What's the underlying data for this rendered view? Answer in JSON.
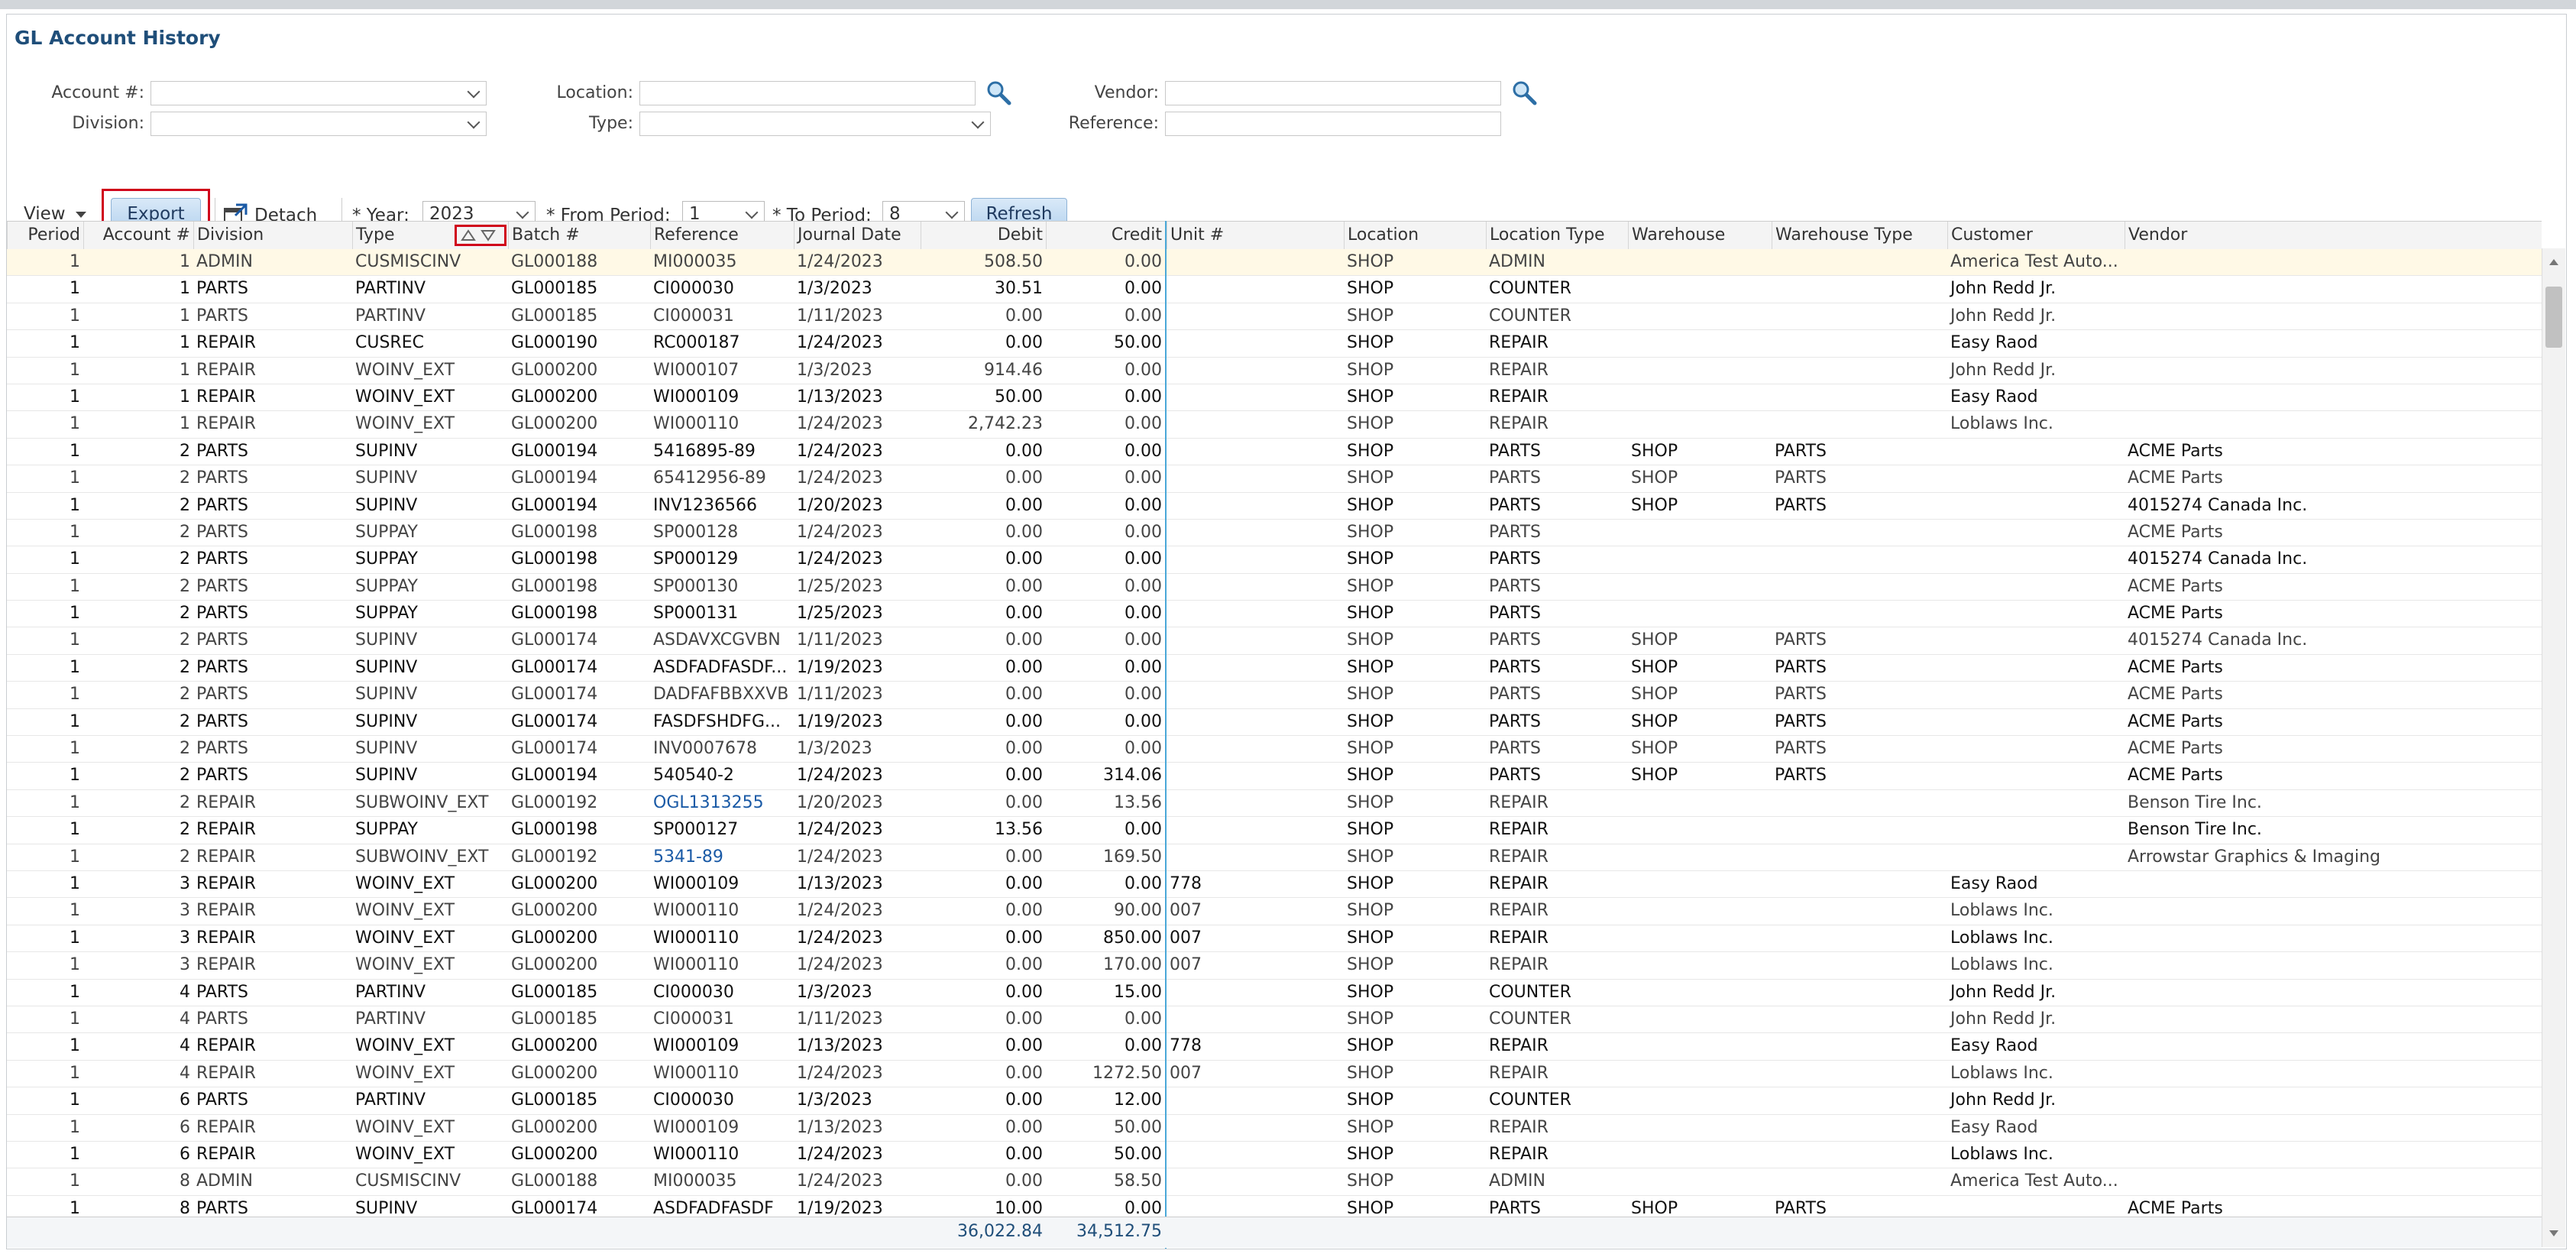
{
  "page": {
    "title": "GL Account History"
  },
  "filters": {
    "account_label": "Account #:",
    "division_label": "Division:",
    "location_label": "Location:",
    "type_label": "Type:",
    "vendor_label": "Vendor:",
    "reference_label": "Reference:",
    "account_value": "",
    "division_value": "",
    "location_value": "",
    "type_value": "",
    "vendor_value": "",
    "reference_value": ""
  },
  "toolbar": {
    "view_label": "View",
    "export_label": "Export",
    "detach_label": "Detach",
    "year_label": "* Year:",
    "year_value": "2023",
    "from_label": "* From Period:",
    "from_value": "1",
    "to_label": "* To Period:",
    "to_value": "8",
    "refresh_label": "Refresh"
  },
  "grid": {
    "columns": [
      "Period",
      "Account #",
      "Division",
      "Type",
      "Batch #",
      "Reference",
      "Journal Date",
      "Debit",
      "Credit",
      "Unit #",
      "Location",
      "Location Type",
      "Warehouse",
      "Warehouse Type",
      "Customer",
      "Vendor"
    ],
    "rows": [
      [
        "1",
        "1",
        "ADMIN",
        "CUSMISCINV",
        "GL000188",
        "MI000035",
        "1/24/2023",
        "508.50",
        "0.00",
        "",
        "SHOP",
        "ADMIN",
        "",
        "",
        "America Test Auto...",
        ""
      ],
      [
        "1",
        "1",
        "PARTS",
        "PARTINV",
        "GL000185",
        "CI000030",
        "1/3/2023",
        "30.51",
        "0.00",
        "",
        "SHOP",
        "COUNTER",
        "",
        "",
        "John Redd Jr.",
        ""
      ],
      [
        "1",
        "1",
        "PARTS",
        "PARTINV",
        "GL000185",
        "CI000031",
        "1/11/2023",
        "0.00",
        "0.00",
        "",
        "SHOP",
        "COUNTER",
        "",
        "",
        "John Redd Jr.",
        ""
      ],
      [
        "1",
        "1",
        "REPAIR",
        "CUSREC",
        "GL000190",
        "RC000187",
        "1/24/2023",
        "0.00",
        "50.00",
        "",
        "SHOP",
        "REPAIR",
        "",
        "",
        "Easy Raod",
        ""
      ],
      [
        "1",
        "1",
        "REPAIR",
        "WOINV_EXT",
        "GL000200",
        "WI000107",
        "1/3/2023",
        "914.46",
        "0.00",
        "",
        "SHOP",
        "REPAIR",
        "",
        "",
        "John Redd Jr.",
        ""
      ],
      [
        "1",
        "1",
        "REPAIR",
        "WOINV_EXT",
        "GL000200",
        "WI000109",
        "1/13/2023",
        "50.00",
        "0.00",
        "",
        "SHOP",
        "REPAIR",
        "",
        "",
        "Easy Raod",
        ""
      ],
      [
        "1",
        "1",
        "REPAIR",
        "WOINV_EXT",
        "GL000200",
        "WI000110",
        "1/24/2023",
        "2,742.23",
        "0.00",
        "",
        "SHOP",
        "REPAIR",
        "",
        "",
        "Loblaws Inc.",
        ""
      ],
      [
        "1",
        "2",
        "PARTS",
        "SUPINV",
        "GL000194",
        "5416895-89",
        "1/24/2023",
        "0.00",
        "0.00",
        "",
        "SHOP",
        "PARTS",
        "SHOP",
        "PARTS",
        "",
        "ACME Parts"
      ],
      [
        "1",
        "2",
        "PARTS",
        "SUPINV",
        "GL000194",
        "65412956-89",
        "1/24/2023",
        "0.00",
        "0.00",
        "",
        "SHOP",
        "PARTS",
        "SHOP",
        "PARTS",
        "",
        "ACME Parts"
      ],
      [
        "1",
        "2",
        "PARTS",
        "SUPINV",
        "GL000194",
        "INV1236566",
        "1/20/2023",
        "0.00",
        "0.00",
        "",
        "SHOP",
        "PARTS",
        "SHOP",
        "PARTS",
        "",
        "4015274 Canada Inc."
      ],
      [
        "1",
        "2",
        "PARTS",
        "SUPPAY",
        "GL000198",
        "SP000128",
        "1/24/2023",
        "0.00",
        "0.00",
        "",
        "SHOP",
        "PARTS",
        "",
        "",
        "",
        "ACME Parts"
      ],
      [
        "1",
        "2",
        "PARTS",
        "SUPPAY",
        "GL000198",
        "SP000129",
        "1/24/2023",
        "0.00",
        "0.00",
        "",
        "SHOP",
        "PARTS",
        "",
        "",
        "",
        "4015274 Canada Inc."
      ],
      [
        "1",
        "2",
        "PARTS",
        "SUPPAY",
        "GL000198",
        "SP000130",
        "1/25/2023",
        "0.00",
        "0.00",
        "",
        "SHOP",
        "PARTS",
        "",
        "",
        "",
        "ACME Parts"
      ],
      [
        "1",
        "2",
        "PARTS",
        "SUPPAY",
        "GL000198",
        "SP000131",
        "1/25/2023",
        "0.00",
        "0.00",
        "",
        "SHOP",
        "PARTS",
        "",
        "",
        "",
        "ACME Parts"
      ],
      [
        "1",
        "2",
        "PARTS",
        "SUPINV",
        "GL000174",
        "ASDAVXCGVBN",
        "1/11/2023",
        "0.00",
        "0.00",
        "",
        "SHOP",
        "PARTS",
        "SHOP",
        "PARTS",
        "",
        "4015274 Canada Inc."
      ],
      [
        "1",
        "2",
        "PARTS",
        "SUPINV",
        "GL000174",
        "ASDFADFASDF...",
        "1/19/2023",
        "0.00",
        "0.00",
        "",
        "SHOP",
        "PARTS",
        "SHOP",
        "PARTS",
        "",
        "ACME Parts"
      ],
      [
        "1",
        "2",
        "PARTS",
        "SUPINV",
        "GL000174",
        "DADFAFBBXXVB",
        "1/11/2023",
        "0.00",
        "0.00",
        "",
        "SHOP",
        "PARTS",
        "SHOP",
        "PARTS",
        "",
        "ACME Parts"
      ],
      [
        "1",
        "2",
        "PARTS",
        "SUPINV",
        "GL000174",
        "FASDFSHDFG...",
        "1/19/2023",
        "0.00",
        "0.00",
        "",
        "SHOP",
        "PARTS",
        "SHOP",
        "PARTS",
        "",
        "ACME Parts"
      ],
      [
        "1",
        "2",
        "PARTS",
        "SUPINV",
        "GL000174",
        "INV0007678",
        "1/3/2023",
        "0.00",
        "0.00",
        "",
        "SHOP",
        "PARTS",
        "SHOP",
        "PARTS",
        "",
        "ACME Parts"
      ],
      [
        "1",
        "2",
        "PARTS",
        "SUPINV",
        "GL000194",
        "540540-2",
        "1/24/2023",
        "0.00",
        "314.06",
        "",
        "SHOP",
        "PARTS",
        "SHOP",
        "PARTS",
        "",
        "ACME Parts"
      ],
      [
        "1",
        "2",
        "REPAIR",
        "SUBWOINV_EXT",
        "GL000192",
        "OGL1313255",
        "1/20/2023",
        "0.00",
        "13.56",
        "",
        "SHOP",
        "REPAIR",
        "",
        "",
        "",
        "Benson Tire Inc."
      ],
      [
        "1",
        "2",
        "REPAIR",
        "SUPPAY",
        "GL000198",
        "SP000127",
        "1/24/2023",
        "13.56",
        "0.00",
        "",
        "SHOP",
        "REPAIR",
        "",
        "",
        "",
        "Benson Tire Inc."
      ],
      [
        "1",
        "2",
        "REPAIR",
        "SUBWOINV_EXT",
        "GL000192",
        "5341-89",
        "1/24/2023",
        "0.00",
        "169.50",
        "",
        "SHOP",
        "REPAIR",
        "",
        "",
        "",
        "Arrowstar Graphics & Imaging"
      ],
      [
        "1",
        "3",
        "REPAIR",
        "WOINV_EXT",
        "GL000200",
        "WI000109",
        "1/13/2023",
        "0.00",
        "0.00",
        "778",
        "SHOP",
        "REPAIR",
        "",
        "",
        "Easy Raod",
        ""
      ],
      [
        "1",
        "3",
        "REPAIR",
        "WOINV_EXT",
        "GL000200",
        "WI000110",
        "1/24/2023",
        "0.00",
        "90.00",
        "007",
        "SHOP",
        "REPAIR",
        "",
        "",
        "Loblaws Inc.",
        ""
      ],
      [
        "1",
        "3",
        "REPAIR",
        "WOINV_EXT",
        "GL000200",
        "WI000110",
        "1/24/2023",
        "0.00",
        "850.00",
        "007",
        "SHOP",
        "REPAIR",
        "",
        "",
        "Loblaws Inc.",
        ""
      ],
      [
        "1",
        "3",
        "REPAIR",
        "WOINV_EXT",
        "GL000200",
        "WI000110",
        "1/24/2023",
        "0.00",
        "170.00",
        "007",
        "SHOP",
        "REPAIR",
        "",
        "",
        "Loblaws Inc.",
        ""
      ],
      [
        "1",
        "4",
        "PARTS",
        "PARTINV",
        "GL000185",
        "CI000030",
        "1/3/2023",
        "0.00",
        "15.00",
        "",
        "SHOP",
        "COUNTER",
        "",
        "",
        "John Redd Jr.",
        ""
      ],
      [
        "1",
        "4",
        "PARTS",
        "PARTINV",
        "GL000185",
        "CI000031",
        "1/11/2023",
        "0.00",
        "0.00",
        "",
        "SHOP",
        "COUNTER",
        "",
        "",
        "John Redd Jr.",
        ""
      ],
      [
        "1",
        "4",
        "REPAIR",
        "WOINV_EXT",
        "GL000200",
        "WI000109",
        "1/13/2023",
        "0.00",
        "0.00",
        "778",
        "SHOP",
        "REPAIR",
        "",
        "",
        "Easy Raod",
        ""
      ],
      [
        "1",
        "4",
        "REPAIR",
        "WOINV_EXT",
        "GL000200",
        "WI000110",
        "1/24/2023",
        "0.00",
        "1272.50",
        "007",
        "SHOP",
        "REPAIR",
        "",
        "",
        "Loblaws Inc.",
        ""
      ],
      [
        "1",
        "6",
        "PARTS",
        "PARTINV",
        "GL000185",
        "CI000030",
        "1/3/2023",
        "0.00",
        "12.00",
        "",
        "SHOP",
        "COUNTER",
        "",
        "",
        "John Redd Jr.",
        ""
      ],
      [
        "1",
        "6",
        "REPAIR",
        "WOINV_EXT",
        "GL000200",
        "WI000109",
        "1/13/2023",
        "0.00",
        "50.00",
        "",
        "SHOP",
        "REPAIR",
        "",
        "",
        "Easy Raod",
        ""
      ],
      [
        "1",
        "6",
        "REPAIR",
        "WOINV_EXT",
        "GL000200",
        "WI000110",
        "1/24/2023",
        "0.00",
        "50.00",
        "",
        "SHOP",
        "REPAIR",
        "",
        "",
        "Loblaws Inc.",
        ""
      ],
      [
        "1",
        "8",
        "ADMIN",
        "CUSMISCINV",
        "GL000188",
        "MI000035",
        "1/24/2023",
        "0.00",
        "58.50",
        "",
        "SHOP",
        "ADMIN",
        "",
        "",
        "America Test Auto...",
        ""
      ],
      [
        "1",
        "8",
        "PARTS",
        "SUPINV",
        "GL000174",
        "ASDFADFASDF",
        "1/19/2023",
        "10.00",
        "0.00",
        "",
        "SHOP",
        "PARTS",
        "SHOP",
        "PARTS",
        "",
        "ACME Parts"
      ]
    ],
    "bold_rows": [
      1,
      3,
      5,
      7,
      9,
      11,
      13,
      15,
      17,
      19,
      21,
      23,
      25,
      27,
      29,
      31,
      33,
      35
    ],
    "link_refs": [
      20,
      22
    ],
    "totals": {
      "debit": "36,022.84",
      "credit": "34,512.75"
    }
  },
  "colors": {
    "title": "#1f4e79",
    "link": "#1a5aa6",
    "highlight_border": "#d0021b",
    "selected_row": "#fff9e6",
    "divider": "#4aa8d8"
  }
}
